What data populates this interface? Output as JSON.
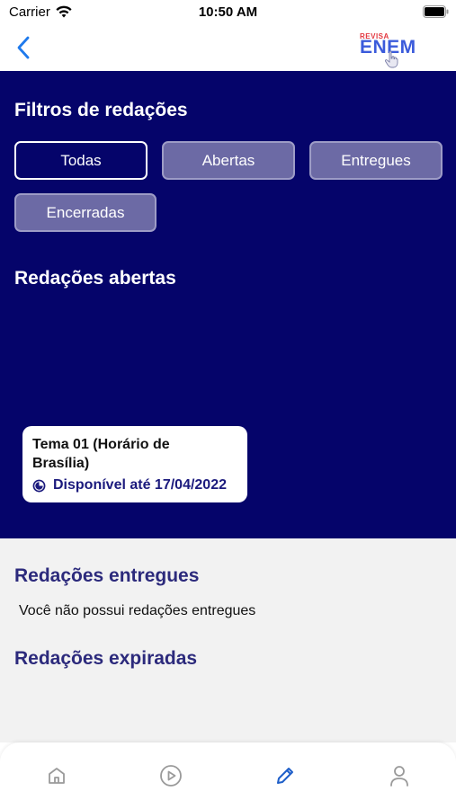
{
  "status_bar": {
    "carrier": "Carrier",
    "time": "10:50 AM"
  },
  "header": {
    "logo_top": "REVISA",
    "logo_main": "ENEM"
  },
  "filters": {
    "title": "Filtros de redações",
    "buttons": [
      {
        "label": "Todas",
        "active": true
      },
      {
        "label": "Abertas",
        "active": false
      },
      {
        "label": "Entregues",
        "active": false
      },
      {
        "label": "Encerradas",
        "active": false
      }
    ]
  },
  "open_essays": {
    "title": "Redações abertas",
    "items": [
      {
        "title": "Tema 01 (Horário de Brasília)",
        "availability": "Disponível até 17/04/2022"
      }
    ]
  },
  "delivered_essays": {
    "title": "Redações entregues",
    "empty_message": "Você não possui redações entregues"
  },
  "expired_essays": {
    "title": "Redações expiradas"
  },
  "tab_bar": {
    "tabs": [
      {
        "icon": "home-icon",
        "active": false
      },
      {
        "icon": "play-icon",
        "active": false
      },
      {
        "icon": "pencil-icon",
        "active": true
      },
      {
        "icon": "user-icon",
        "active": false
      }
    ]
  },
  "colors": {
    "primary": "#05046a",
    "accent": "#2c2a7c",
    "active_tab": "#1e5fc9",
    "inactive_tab": "#9a9a9a"
  }
}
